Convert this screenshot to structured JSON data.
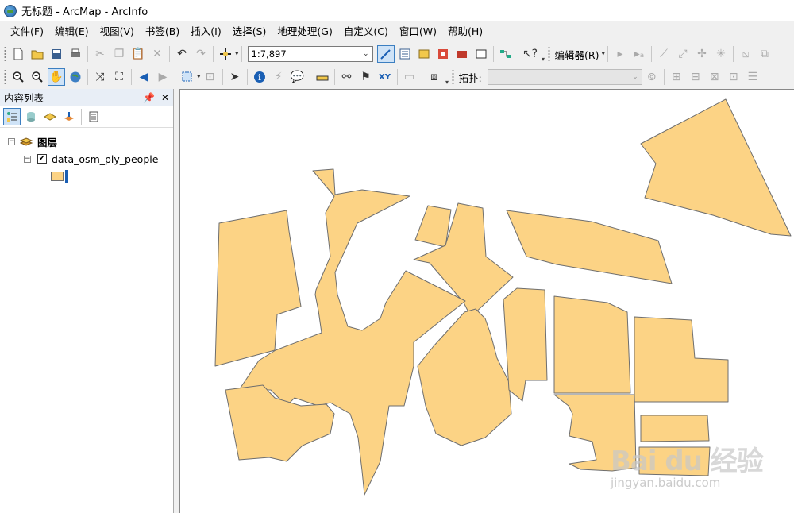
{
  "window": {
    "title": "无标题 - ArcMap - ArcInfo",
    "icon": "arcmap-globe-icon"
  },
  "menu": [
    "文件(F)",
    "编辑(E)",
    "视图(V)",
    "书签(B)",
    "插入(I)",
    "选择(S)",
    "地理处理(G)",
    "自定义(C)",
    "窗口(W)",
    "帮助(H)"
  ],
  "toolbar": {
    "scale": "1:7,897",
    "editor_label": "编辑器(R)",
    "topology_label": "拓扑:",
    "topology_value": ""
  },
  "toc": {
    "title": "内容列表",
    "pin_icon": "pin-icon",
    "close_icon": "close-icon",
    "group_label": "图层",
    "layer_name": "data_osm_ply_people",
    "layer_checked": true,
    "symbol_fill": "#fcd385",
    "symbol_outline": "#6e6e6e"
  },
  "watermark": {
    "main": "Bai du 经验",
    "sub": "jingyan.baidu.com"
  }
}
